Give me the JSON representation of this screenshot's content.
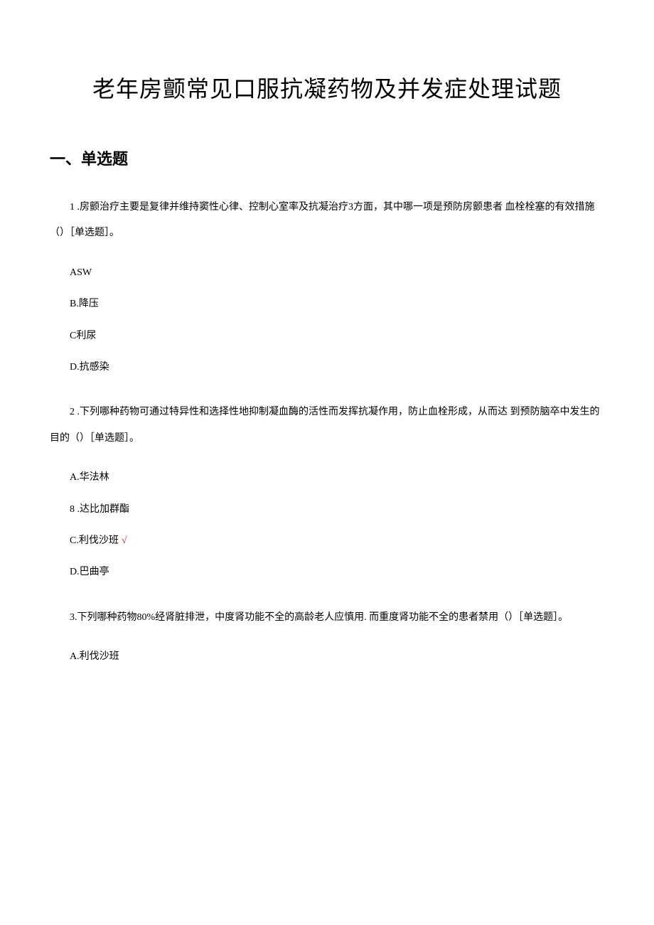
{
  "title": "老年房颤常见口服抗凝药物及并发症处理试题",
  "section": "一、单选题",
  "questions": [
    {
      "stem": "1 .房颤治疗主要是复律并维持窦性心律、控制心室率及抗凝治疗3方面，其中哪一项是预防房颤患者 血栓栓塞的有效措施（）［单选题］。",
      "options": [
        {
          "text": "ASW",
          "correct": false
        },
        {
          "text": "B.降压",
          "correct": false
        },
        {
          "text": "C利尿",
          "correct": false
        },
        {
          "text": "D.抗感染",
          "correct": false
        }
      ]
    },
    {
      "stem": "2 .下列哪种药物可通过特异性和选择性地抑制凝血酶的活性而发挥抗凝作用，防止血栓形成，从而达 到预防脑卒中发生的目的（）［单选题］。",
      "options": [
        {
          "text": "A.华法林",
          "correct": false
        },
        {
          "text": "8       .达比加群酯",
          "correct": false
        },
        {
          "text": "C.利伐沙班",
          "correct": true
        },
        {
          "text": "D.巴曲亭",
          "correct": false
        }
      ]
    },
    {
      "stem": "3.下列哪种药物80%经肾脏排泄，中度肾功能不全的高龄老人应慎用. 而重度肾功能不全的患者禁用（）［单选题］。",
      "options": [
        {
          "text": "A.利伐沙班",
          "correct": false
        }
      ]
    }
  ],
  "correct_mark": "√"
}
